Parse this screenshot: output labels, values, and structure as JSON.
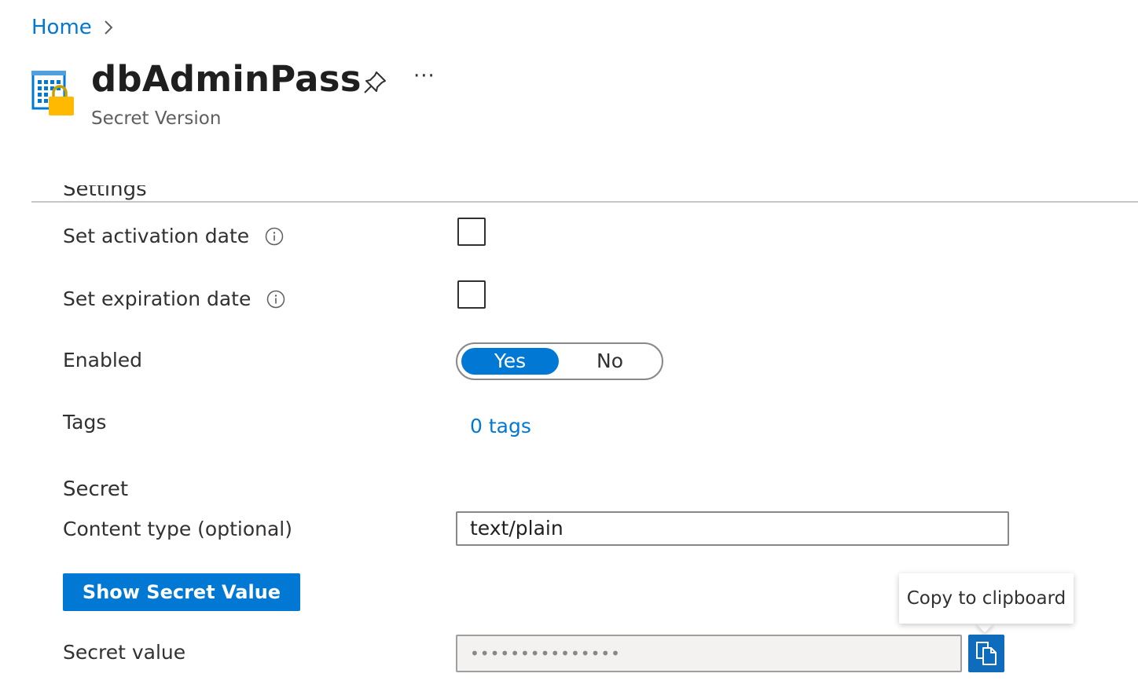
{
  "breadcrumb": {
    "home": "Home"
  },
  "header": {
    "title": "dbAdminPass",
    "subtitle": "Secret Version",
    "more": "···"
  },
  "settings": {
    "heading": "Settings",
    "activation_label": "Set activation date",
    "expiration_label": "Set expiration date",
    "enabled_label": "Enabled",
    "enabled_yes": "Yes",
    "enabled_no": "No",
    "enabled_value": "Yes",
    "activation_checked": false,
    "expiration_checked": false,
    "tags_label": "Tags",
    "tags_link": "0 tags"
  },
  "secret": {
    "section": "Secret",
    "content_type_label": "Content type (optional)",
    "content_type_value": "text/plain",
    "show_button": "Show Secret Value",
    "value_label": "Secret value",
    "masked_value": "•••••••••••••••",
    "tooltip": "Copy to clipboard"
  },
  "colors": {
    "accent": "#0078d4",
    "key_lock": "#ffb900"
  }
}
